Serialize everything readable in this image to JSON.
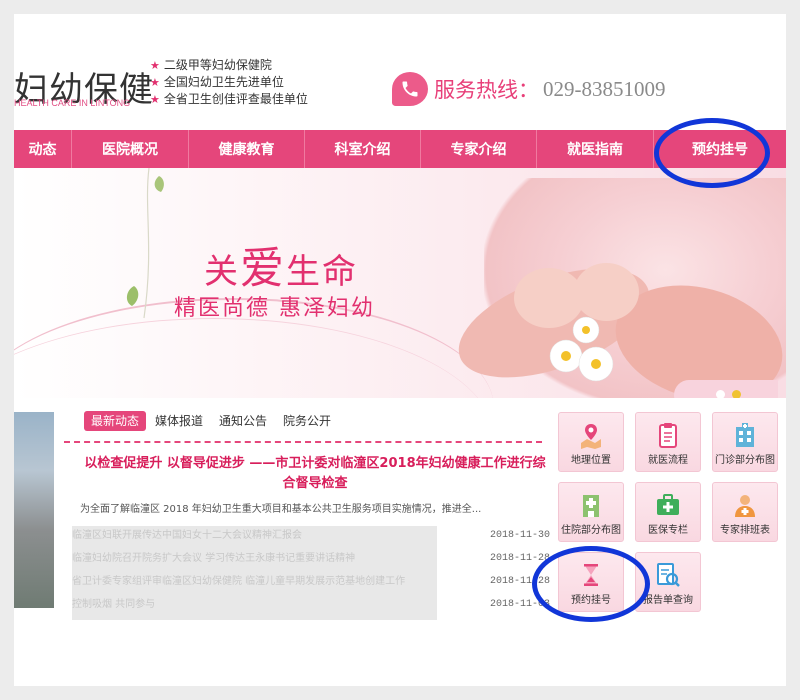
{
  "header": {
    "logo_name": "妇幼保健",
    "logo_sub": "HEALTH CARE IN LINTONG",
    "honors": [
      "二级甲等妇幼保健院",
      "全国妇幼卫生先进单位",
      "全省卫生创佳评查最佳单位"
    ],
    "hotline_label": "服务热线：",
    "hotline_number": "029-83851009"
  },
  "nav": {
    "items": [
      {
        "label": "动态",
        "icon": ""
      },
      {
        "label": "医院概况"
      },
      {
        "label": "健康教育"
      },
      {
        "label": "科室介绍"
      },
      {
        "label": "专家介绍"
      },
      {
        "label": "就医指南"
      },
      {
        "label": "预约挂号"
      }
    ]
  },
  "banner": {
    "slogan_a": "关",
    "slogan_b": "爱",
    "slogan_c": "生命",
    "slogan2": "精医尚德  惠泽妇幼"
  },
  "news": {
    "tabs": [
      "最新动态",
      "媒体报道",
      "通知公告",
      "院务公开"
    ],
    "headline": "以检查促提升 以督导促进步 ——市卫计委对临潼区2018年妇幼健康工作进行综合督导检查",
    "summary": "为全面了解临潼区 2018 年妇幼卫生重大项目和基本公共卫生服务项目实施情况，推进全...",
    "items": [
      {
        "title": "临潼区妇联开展传达中国妇女十二大会议精神汇报会",
        "date": "2018-11-30"
      },
      {
        "title": "临潼妇幼院召开院务扩大会议 学习传达王永康书记重要讲话精神",
        "date": "2018-11-28"
      },
      {
        "title": "省卫计委专家组评审临潼区妇幼保健院 临潼儿童早期发展示范基地创建工作",
        "date": "2018-11-28"
      },
      {
        "title": "控制吸烟 共同参与",
        "date": "2018-11-03"
      }
    ]
  },
  "services": [
    {
      "label": "地理位置",
      "icon": "map-location-icon"
    },
    {
      "label": "就医流程",
      "icon": "clipboard-icon"
    },
    {
      "label": "门诊部分布图",
      "icon": "hospital-building-icon"
    },
    {
      "label": "住院部分布图",
      "icon": "inpatient-building-icon"
    },
    {
      "label": "医保专栏",
      "icon": "medical-kit-icon"
    },
    {
      "label": "专家排班表",
      "icon": "doctor-icon"
    },
    {
      "label": "预约挂号",
      "icon": "hourglass-icon"
    },
    {
      "label": "报告单查询",
      "icon": "report-search-icon"
    }
  ],
  "colors": {
    "brand": "#e5467b",
    "accent": "#e2306f",
    "annotation": "#1136d8"
  }
}
